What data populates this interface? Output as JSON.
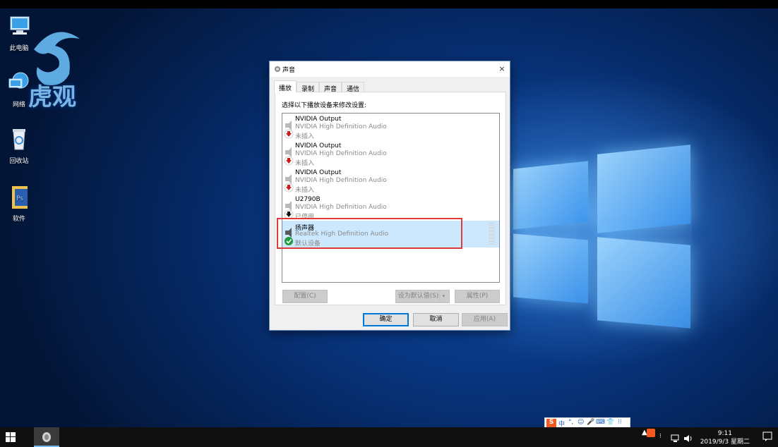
{
  "desktop": {
    "icons": [
      {
        "label": "此电脑"
      },
      {
        "label": "网络"
      },
      {
        "label": "回收站"
      },
      {
        "label": "软件"
      }
    ],
    "watermark_text": "虎观"
  },
  "dialog": {
    "title": "声音",
    "close_glyph": "×",
    "tabs": [
      {
        "label": "播放",
        "active": true
      },
      {
        "label": "录制",
        "active": false
      },
      {
        "label": "声音",
        "active": false
      },
      {
        "label": "通信",
        "active": false
      }
    ],
    "instruction": "选择以下播放设备来修改设置:",
    "devices": [
      {
        "name": "NVIDIA Output",
        "driver": "NVIDIA High Definition Audio",
        "status": "未插入",
        "status_icon": "unplugged-red-arrow-icon",
        "selected": false
      },
      {
        "name": "NVIDIA Output",
        "driver": "NVIDIA High Definition Audio",
        "status": "未插入",
        "status_icon": "unplugged-red-arrow-icon",
        "selected": false
      },
      {
        "name": "NVIDIA Output",
        "driver": "NVIDIA High Definition Audio",
        "status": "未插入",
        "status_icon": "unplugged-red-arrow-icon",
        "selected": false
      },
      {
        "name": "U2790B",
        "driver": "NVIDIA High Definition Audio",
        "status": "已停用",
        "status_icon": "disabled-black-arrow-icon",
        "selected": false
      },
      {
        "name": "扬声器",
        "driver": "Realtek High Definition Audio",
        "status": "默认设备",
        "status_icon": "default-green-check-icon",
        "selected": true
      }
    ],
    "buttons": {
      "configure": "配置(C)",
      "set_default": "设为默认值(S)",
      "properties": "属性(P)",
      "ok": "确定",
      "cancel": "取消",
      "apply": "应用(A)"
    }
  },
  "ime_bar": {
    "items": [
      "S",
      "中",
      "°,",
      "☺",
      "🎤",
      "⌨",
      "👕",
      "⁝⁝"
    ]
  },
  "taskbar": {
    "time": "9:11",
    "date": "2019/9/3 星期二"
  },
  "colors": {
    "selection": "#cce8ff",
    "highlight_border": "#e03a3a",
    "accent": "#0078d7"
  }
}
